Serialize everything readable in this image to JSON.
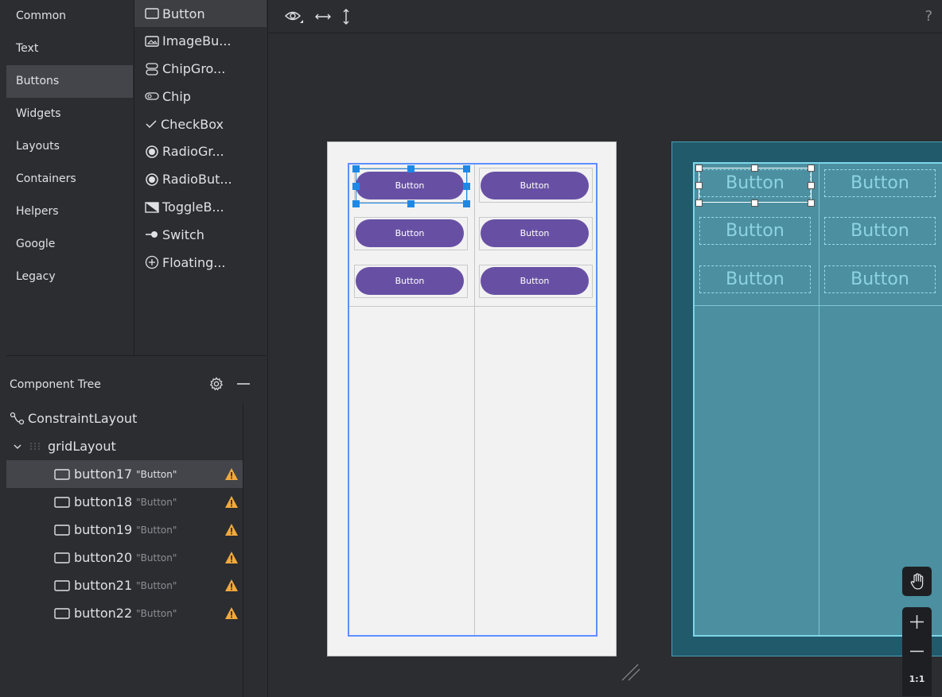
{
  "palette": {
    "categories": [
      "Common",
      "Text",
      "Buttons",
      "Widgets",
      "Layouts",
      "Containers",
      "Helpers",
      "Google",
      "Legacy"
    ],
    "selected_category": "Buttons",
    "widgets": [
      "Button",
      "ImageBu...",
      "ChipGro...",
      "Chip",
      "CheckBox",
      "RadioGr...",
      "RadioBut...",
      "ToggleB...",
      "Switch",
      "Floating..."
    ],
    "widget_icons": [
      "button-icon",
      "image-button-icon",
      "chip-group-icon",
      "chip-icon",
      "checkmark-icon",
      "radio-group-icon",
      "radio-button-icon",
      "toggle-button-icon",
      "switch-icon",
      "floating-action-button-icon"
    ]
  },
  "component_tree": {
    "title": "Component Tree",
    "root": "ConstraintLayout",
    "grid": "gridLayout",
    "buttons": [
      {
        "id": "button17",
        "text": "\"Button\""
      },
      {
        "id": "button18",
        "text": "\"Button\""
      },
      {
        "id": "button19",
        "text": "\"Button\""
      },
      {
        "id": "button20",
        "text": "\"Button\""
      },
      {
        "id": "button21",
        "text": "\"Button\""
      },
      {
        "id": "button22",
        "text": "\"Button\""
      }
    ]
  },
  "canvas": {
    "help": "?",
    "button_label": "Button",
    "zoom_reset": "1:1"
  },
  "colors": {
    "button_fill": "#6750a4",
    "selection": "#1e88e5",
    "warning": "#f2a93b",
    "blueprint_bg": "#215a6b"
  }
}
